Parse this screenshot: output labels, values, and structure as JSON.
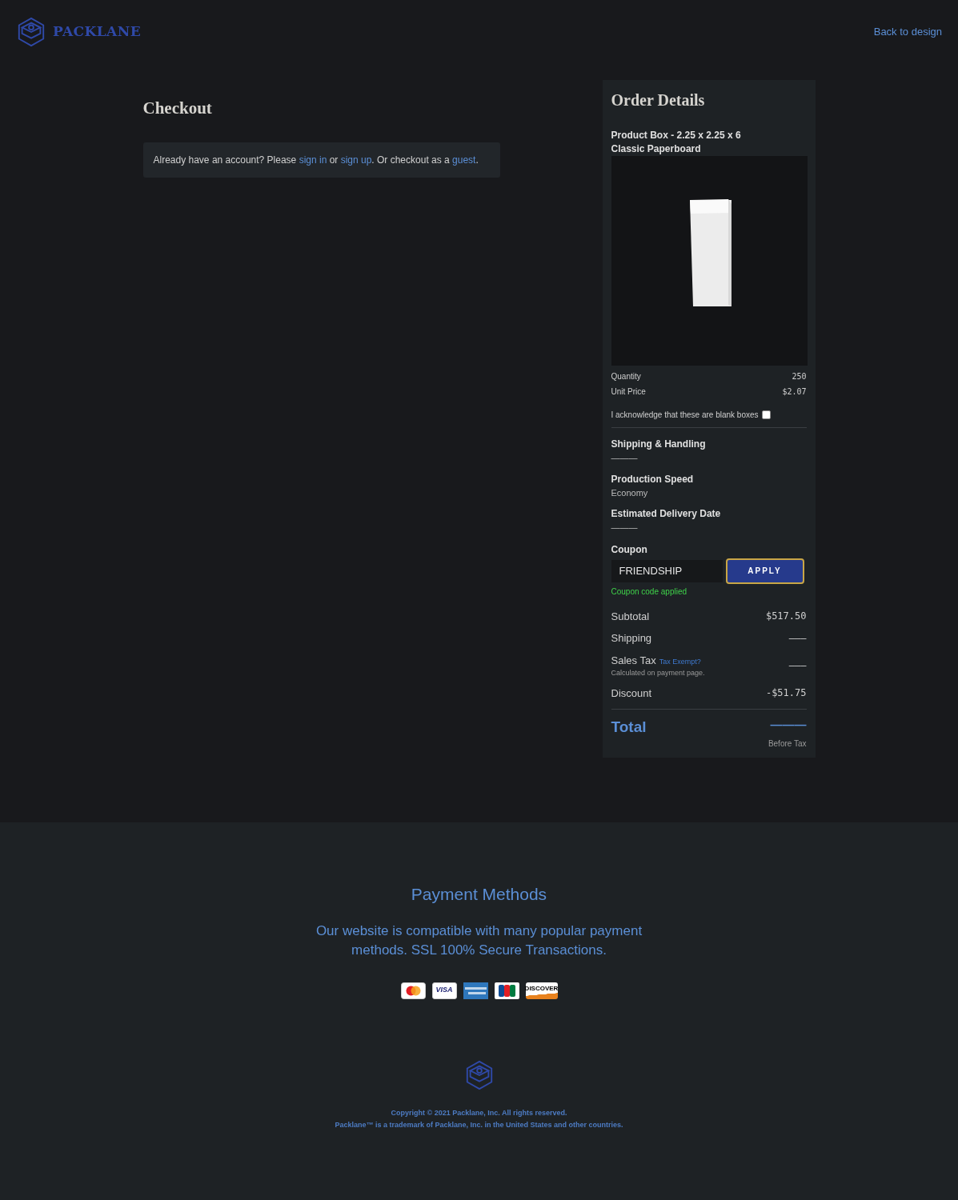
{
  "header": {
    "brand": "PACKLANE",
    "back_link": "Back to design"
  },
  "checkout": {
    "title": "Checkout",
    "notice": "Already have an account? Please ",
    "sign_in": "sign in",
    "or": " or ",
    "sign_up": "sign up",
    "rest": ". Or checkout as a ",
    "guest": "guest",
    "end": "."
  },
  "order": {
    "title": "Order Details",
    "product": "Product Box - 2.25 x 2.25 x 6",
    "material": "Classic Paperboard",
    "specs": [
      {
        "label": "Quantity",
        "value": "250"
      },
      {
        "label": "Unit Price",
        "value": "$2.07"
      }
    ],
    "acknowledge": {
      "label": "I acknowledge that these are blank boxes",
      "checked": false
    },
    "details": [
      {
        "label": "Shipping & Handling",
        "value": "———"
      },
      {
        "label": "Production Speed",
        "value": "Economy"
      },
      {
        "label": "Estimated Delivery Date",
        "value": "———"
      }
    ],
    "coupon": {
      "label": "Coupon",
      "value": "FRIENDSHIP",
      "button": "APPLY",
      "message": "Coupon code applied"
    },
    "summary": [
      {
        "label": "Subtotal",
        "value": "$517.50"
      },
      {
        "label": "Shipping",
        "value": "———"
      },
      {
        "label": "Sales Tax",
        "link": "Tax Exempt?",
        "note": "Calculated on payment page.",
        "value": "———"
      },
      {
        "label": "Discount",
        "value": "-$51.75"
      }
    ],
    "total": {
      "label": "Total",
      "value": "———",
      "note": "Before Tax"
    }
  },
  "footer": {
    "title": "Payment Methods",
    "text": "Our website is compatible with many popular payment methods. SSL 100% Secure Transactions.",
    "cards": [
      {
        "kind": "mastercard"
      },
      {
        "kind": "visa",
        "label": "VISA"
      },
      {
        "kind": "amex"
      },
      {
        "kind": "jcb"
      },
      {
        "kind": "discover",
        "label": "DISCOVER"
      }
    ],
    "copyright": "Copyright © 2021 Packlane, Inc. All rights reserved.",
    "trademark": "Packlane™ is a trademark of Packlane, Inc. in the United States and other countries."
  }
}
